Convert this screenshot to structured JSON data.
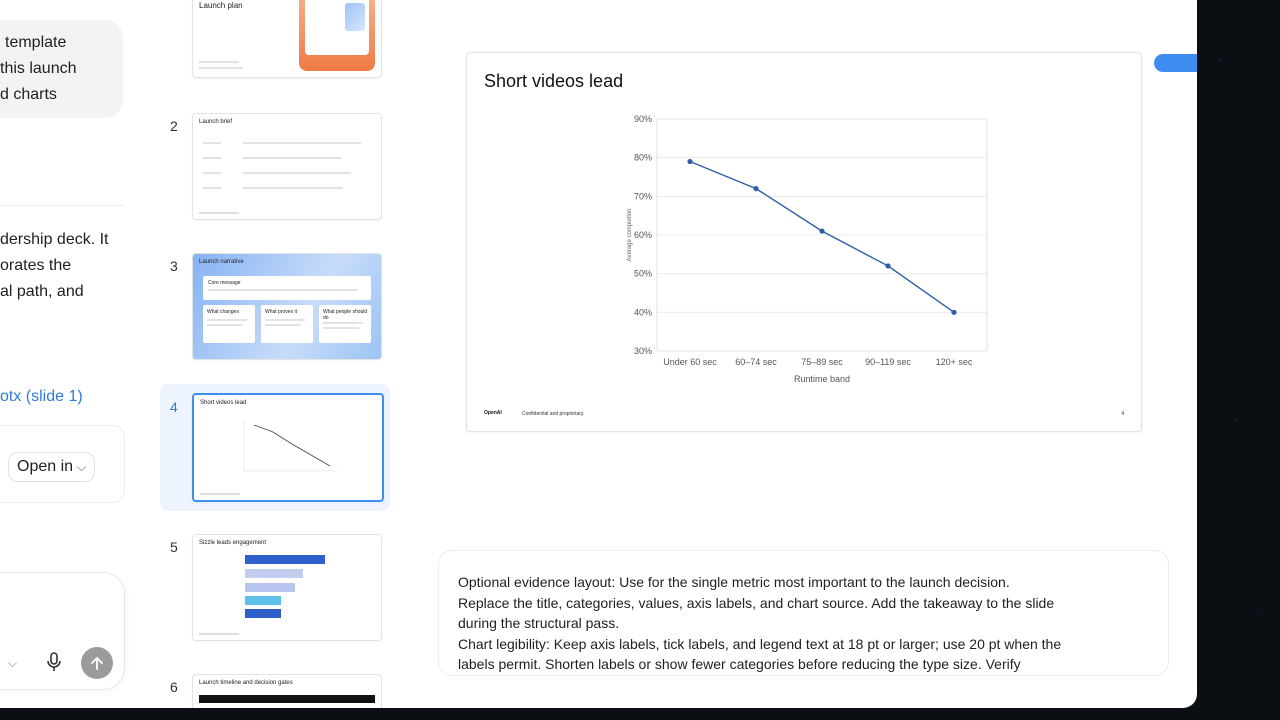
{
  "chat": {
    "bubble_lines": [
      "template",
      "this launch",
      "d charts"
    ],
    "response_lines": [
      "dership deck. It",
      "orates the",
      "al path, and"
    ],
    "file_link": "otx (slide 1)",
    "open_in_label": "Open in"
  },
  "thumbnails": [
    {
      "num": "",
      "title": "Launch plan"
    },
    {
      "num": "2",
      "title": "Launch brief"
    },
    {
      "num": "3",
      "title": "Launch narrative",
      "box_titles": [
        "Core message",
        "What changes",
        "What proves it",
        "What people should do"
      ]
    },
    {
      "num": "4",
      "title": "Short videos lead"
    },
    {
      "num": "5",
      "title": "Sizzle leads engagement"
    },
    {
      "num": "6",
      "title": "Launch timeline and decision gates"
    }
  ],
  "slide": {
    "title": "Short videos lead",
    "brand": "OpenAI",
    "footer": "Confidential and proprietary.",
    "page": "4"
  },
  "chart_data": {
    "type": "line",
    "title": "Short videos lead",
    "xlabel": "Runtime band",
    "ylabel": "Average completion",
    "categories": [
      "Under 60 sec",
      "60–74 sec",
      "75–89 sec",
      "90–119 sec",
      "120+ sec"
    ],
    "values": [
      79,
      72,
      61,
      52,
      40
    ],
    "ylim": [
      30,
      90
    ],
    "yticks": [
      "30%",
      "40%",
      "50%",
      "60%",
      "70%",
      "80%",
      "90%"
    ],
    "color": "#2f5ea8",
    "grid": true
  },
  "notes": {
    "lines": [
      "Optional evidence layout: Use for the single metric most important to the launch decision.",
      "Replace the title, categories, values, axis labels, and chart source. Add the takeaway to the slide",
      "during the structural pass.",
      "Chart legibility: Keep axis labels, tick labels, and legend text at 18 pt or larger; use 20 pt when the",
      "labels permit. Shorten labels or show fewer categories before reducing the type size. Verify"
    ]
  },
  "colors": {
    "accent": "#3f8ff0",
    "line": "#2f5ea8",
    "link": "#2f7bd6"
  }
}
